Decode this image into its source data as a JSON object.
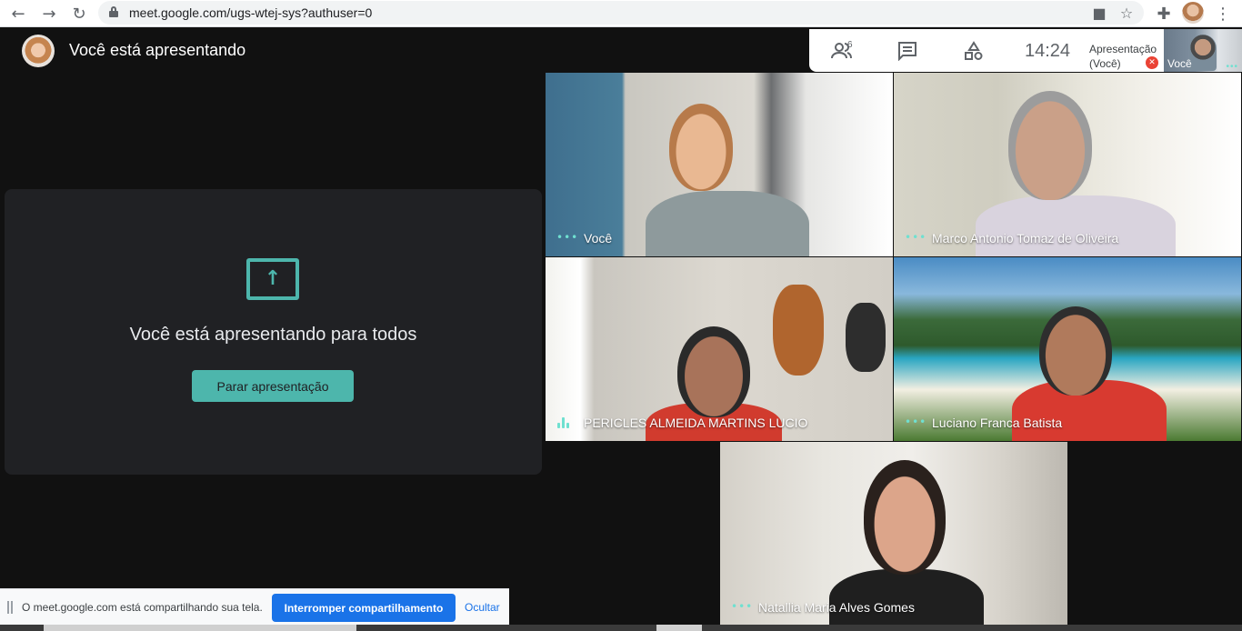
{
  "browser": {
    "url": "meet.google.com/ugs-wtej-sys?authuser=0",
    "icons": [
      "back-arrow-icon",
      "forward-arrow-icon",
      "reload-icon",
      "lock-icon",
      "camera-icon",
      "star-icon",
      "extensions-icon",
      "profile-avatar",
      "more-vert-icon"
    ]
  },
  "header": {
    "title": "Você está apresentando"
  },
  "toolbar": {
    "participants_count": "6",
    "clock": "14:24",
    "icons": [
      "people-icon",
      "chat-icon",
      "activities-icon"
    ]
  },
  "mini_tiles": {
    "presentation_label": "Apresentação (Você)",
    "you_label": "Você"
  },
  "presenting": {
    "message": "Você está apresentando para todos",
    "stop_button": "Parar apresentação",
    "accent_color": "#4db6ac"
  },
  "participants": [
    {
      "name": "Você"
    },
    {
      "name": "Marco Antonio Tomaz de Oliveira"
    },
    {
      "name": "PERICLES ALMEIDA MARTINS LUCIO"
    },
    {
      "name": "Luciano Franca Batista"
    },
    {
      "name": "Natallia Maria Alves Gomes"
    }
  ],
  "share_bar": {
    "message": "O meet.google.com está compartilhando sua tela.",
    "stop_button": "Interromper compartilhamento",
    "hide_link": "Ocultar"
  }
}
